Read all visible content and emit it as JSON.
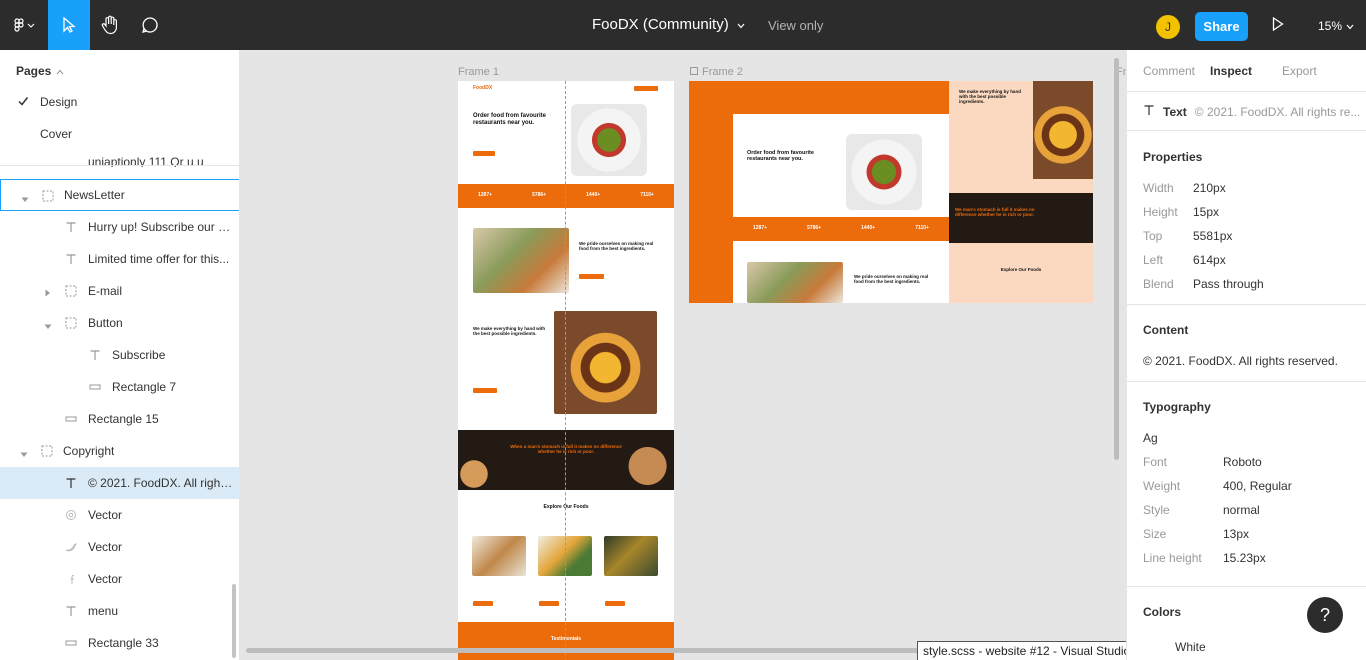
{
  "topbar": {
    "title": "FooDX (Community)",
    "view_only": "View only",
    "avatar_initial": "J",
    "share_label": "Share",
    "zoom": "15%",
    "accent": "#18a0fb"
  },
  "left_panel": {
    "pages_header": "Pages",
    "pages": [
      {
        "label": "Design",
        "current": true
      },
      {
        "label": "Cover",
        "current": false
      }
    ],
    "cut_row": "uniaptionly 111 Qr u u",
    "layers": [
      {
        "label": "NewsLetter",
        "icon": "frame-icon"
      },
      {
        "label": "Hurry up! Subscribe our n...",
        "icon": "text-icon"
      },
      {
        "label": "Limited time offer for this...",
        "icon": "text-icon"
      },
      {
        "label": "E-mail",
        "icon": "frame-icon"
      },
      {
        "label": "Button",
        "icon": "frame-icon"
      },
      {
        "label": "Subscribe",
        "icon": "text-icon"
      },
      {
        "label": "Rectangle 7",
        "icon": "rectangle-icon"
      },
      {
        "label": "Rectangle 15",
        "icon": "rectangle-icon"
      },
      {
        "label": "Copyright",
        "icon": "frame-icon"
      },
      {
        "label": "© 2021. FoodDX. All right...",
        "icon": "text-icon"
      },
      {
        "label": "Vector",
        "icon": "vector-icon"
      },
      {
        "label": "Vector",
        "icon": "vector-icon"
      },
      {
        "label": "Vector",
        "icon": "vector-icon"
      },
      {
        "label": "menu",
        "icon": "text-icon"
      },
      {
        "label": "Rectangle 33",
        "icon": "rectangle-icon"
      }
    ]
  },
  "canvas": {
    "frame1_label": "Frame 1",
    "frame2_label": "Frame 2",
    "frame3_label": "Fr",
    "tooltip": "style.scss - website #12 - Visual Studio Code",
    "brand_color": "#ec6b0b",
    "frame1": {
      "logo": "FoodDX",
      "hero_title": "Order food from favourite restaurants near you.",
      "stats": [
        "1287+",
        "5786+",
        "1440+",
        "7110+"
      ],
      "about_title": "We pride ourselves on making real food from the best ingredients.",
      "about2_title": "We make everything by hand with the best possible ingredients.",
      "quote": "When a man's stomach is full it makes no difference whether he is rich or poor.",
      "explore_title": "Explore Our Foods",
      "testimonials": "Testimonials"
    },
    "frame2": {
      "hero_title": "Order food from favourite restaurants near you.",
      "stats": [
        "1287+",
        "5786+",
        "1440+",
        "7110+"
      ],
      "about_title": "We pride ourselves on making real food from the best ingredients.",
      "right_title": "We make everything by hand with the best possible ingredients.",
      "quote": "We man's stomach is full it makes no difference whether he is rich or poor.",
      "explore_title": "Explore Our Foods"
    }
  },
  "right_panel": {
    "tabs": [
      "Comment",
      "Inspect",
      "Export"
    ],
    "active_tab": "Inspect",
    "layer_type": "Text",
    "layer_name": "© 2021. FoodDX. All rights re...",
    "properties_title": "Properties",
    "properties": [
      {
        "key": "Width",
        "value": "210px"
      },
      {
        "key": "Height",
        "value": "15px"
      },
      {
        "key": "Top",
        "value": "5581px"
      },
      {
        "key": "Left",
        "value": "614px"
      },
      {
        "key": "Blend",
        "value": "Pass through"
      }
    ],
    "content_title": "Content",
    "content_value": "© 2021. FoodDX. All rights reserved.",
    "typography_title": "Typography",
    "typography_sample": "Ag",
    "typography": [
      {
        "key": "Font",
        "value": "Roboto"
      },
      {
        "key": "Weight",
        "value": "400, Regular"
      },
      {
        "key": "Style",
        "value": "normal"
      },
      {
        "key": "Size",
        "value": "13px"
      },
      {
        "key": "Line height",
        "value": "15.23px"
      }
    ],
    "colors_title": "Colors",
    "color_name": "White",
    "help": "?"
  }
}
